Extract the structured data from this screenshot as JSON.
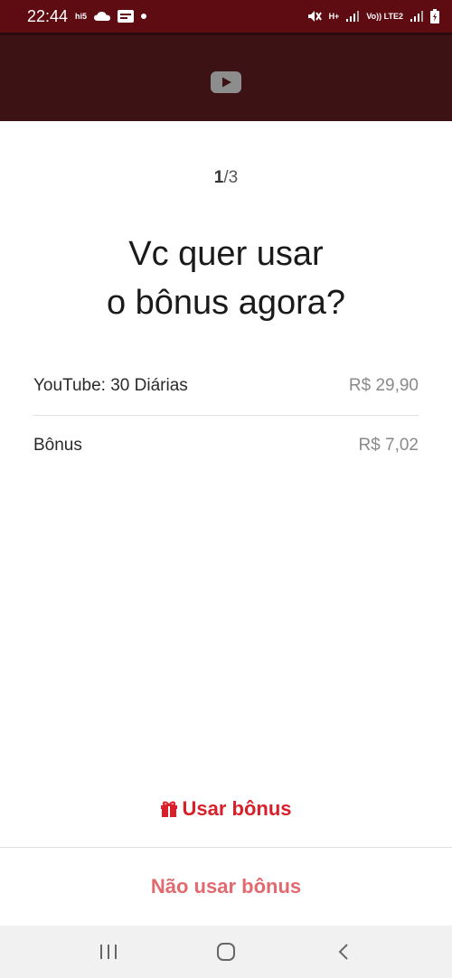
{
  "status_bar": {
    "time": "22:44",
    "left_icons": [
      "hi5-icon",
      "cloud-icon",
      "notification-icon",
      "dot-icon"
    ],
    "hi5_label": "hi5",
    "net1_label": "H+",
    "net2_label": "Vo)) LTE2",
    "right_icons": [
      "mute-icon",
      "signal-icon",
      "signal-icon",
      "battery-charging-icon"
    ]
  },
  "header": {
    "icon": "youtube-play-icon"
  },
  "step": {
    "current": "1",
    "total": "/3"
  },
  "title": {
    "line1": "Vc quer usar",
    "line2": "o bônus agora?"
  },
  "items": [
    {
      "label": "YouTube: 30 Diárias",
      "value": "R$ 29,90"
    },
    {
      "label": "Bônus",
      "value": "R$ 7,02"
    }
  ],
  "actions": {
    "use_bonus": "Usar bônus",
    "no_bonus": "Não usar bônus",
    "use_icon": "gift-icon"
  },
  "nav_bar": {
    "icons": [
      "recent-apps-icon",
      "home-icon",
      "back-icon"
    ]
  },
  "colors": {
    "status_bar": "#5e0b12",
    "header": "#3d1215",
    "accent": "#d8202a",
    "accent_light": "#e26a6f"
  }
}
